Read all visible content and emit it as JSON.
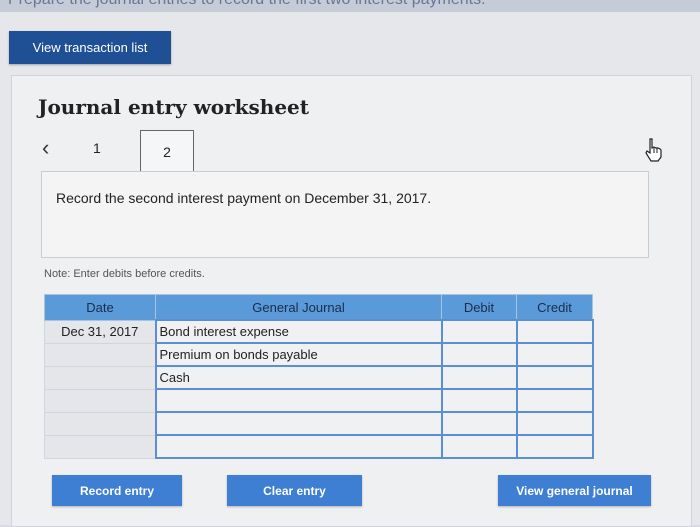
{
  "header": {
    "instruction_banner": "Prepare the journal entries to record the first two interest payments."
  },
  "toolbar": {
    "view_transactions_label": "View transaction list"
  },
  "worksheet": {
    "title": "Journal entry worksheet",
    "nav_prev_icon": "chevron-left-icon",
    "tabs": [
      "1",
      "2"
    ],
    "active_tab": "2",
    "instruction": "Record the second interest payment on December 31, 2017.",
    "note": "Note: Enter debits before credits."
  },
  "journal": {
    "columns": [
      "Date",
      "General Journal",
      "Debit",
      "Credit"
    ],
    "rows": [
      {
        "date": "Dec 31, 2017",
        "account": "Bond interest expense",
        "debit": "",
        "credit": ""
      },
      {
        "date": "",
        "account": "Premium on bonds payable",
        "debit": "",
        "credit": ""
      },
      {
        "date": "",
        "account": "Cash",
        "debit": "",
        "credit": ""
      },
      {
        "date": "",
        "account": "",
        "debit": "",
        "credit": ""
      },
      {
        "date": "",
        "account": "",
        "debit": "",
        "credit": ""
      },
      {
        "date": "",
        "account": "",
        "debit": "",
        "credit": ""
      }
    ]
  },
  "actions": {
    "record_label": "Record entry",
    "clear_label": "Clear entry",
    "view_general_label": "View general journal"
  },
  "colors": {
    "primary_button": "#1f4f94",
    "action_button": "#3e7ed3",
    "table_header": "#5a9ad8",
    "input_border": "#5b8fd1"
  }
}
